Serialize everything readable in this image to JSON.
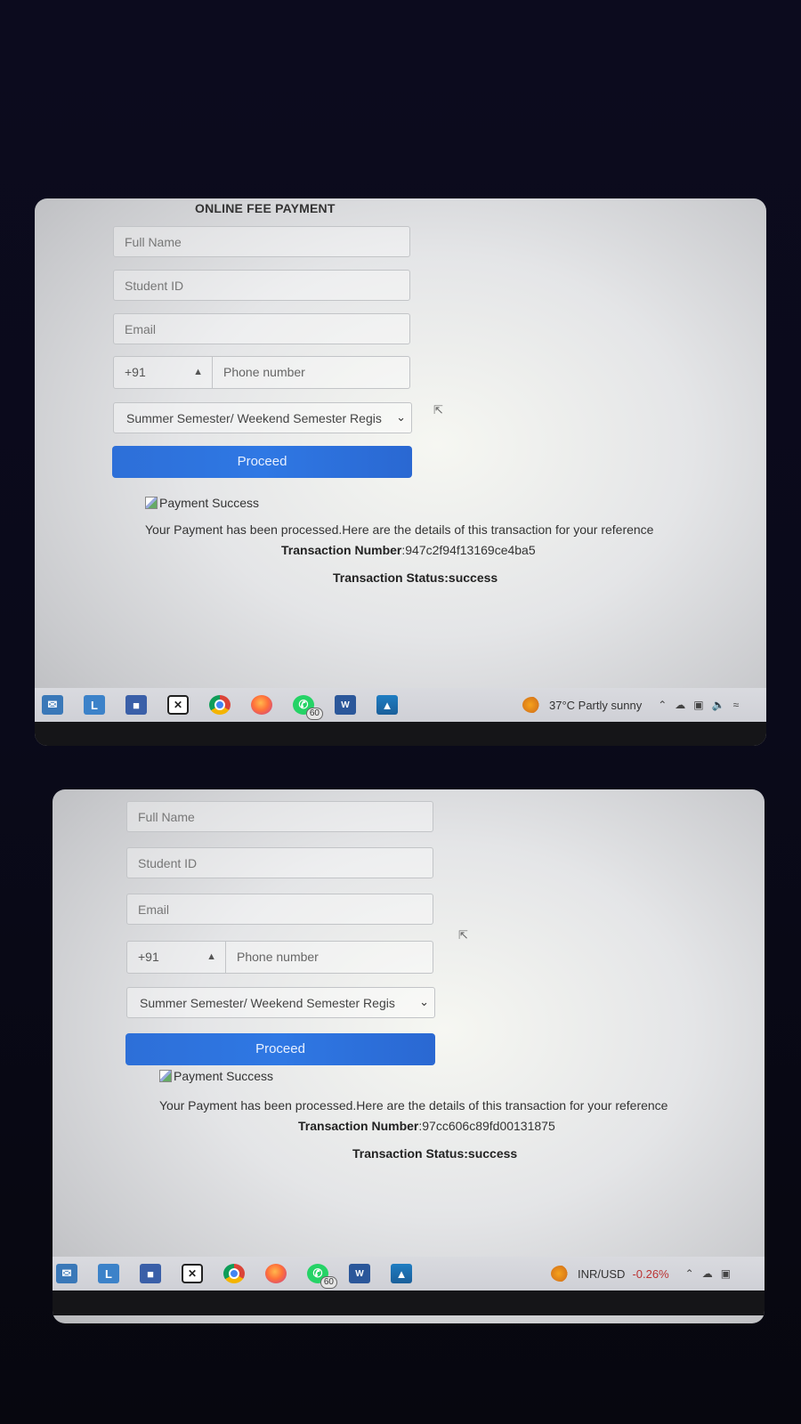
{
  "screens": [
    {
      "form_title": "ONLINE FEE PAYMENT",
      "full_name_placeholder": "Full Name",
      "student_id_placeholder": "Student ID",
      "email_placeholder": "Email",
      "country_code": "+91",
      "phone_placeholder": "Phone number",
      "category_selected": "Summer Semester/ Weekend Semester Regis",
      "proceed_label": "Proceed",
      "success_image_alt": "Payment Success",
      "message": "Your Payment has been processed.Here are the details of this transaction for your reference",
      "transaction_number_label": "Transaction Number",
      "transaction_number": ":947c2f94f13169ce4ba5",
      "transaction_status_label": "Transaction Status",
      "transaction_status": ":success",
      "taskbar_widget_text": "37°C  Partly sunny",
      "whatsapp_badge": "60"
    },
    {
      "full_name_placeholder": "Full Name",
      "student_id_placeholder": "Student ID",
      "email_placeholder": "Email",
      "country_code": "+91",
      "phone_placeholder": "Phone number",
      "category_selected": "Summer Semester/ Weekend Semester Regis",
      "proceed_label": "Proceed",
      "success_image_alt": "Payment Success",
      "message": "Your Payment has been processed.Here are the details of this transaction for your reference",
      "transaction_number_label": "Transaction Number",
      "transaction_number": ":97cc606c89fd00131875",
      "transaction_status_label": "Transaction Status",
      "transaction_status": ":success",
      "taskbar_widget_name": "INR/USD",
      "taskbar_widget_value": "-0.26%",
      "whatsapp_badge": "60"
    }
  ],
  "icons": {
    "taskbar": [
      "mail-icon",
      "l-app-icon",
      "store-icon",
      "xbox-icon",
      "chrome-icon",
      "firefox-icon",
      "whatsapp-icon",
      "word-icon",
      "photos-icon"
    ],
    "tray": [
      "chevron-up-icon",
      "cloud-icon",
      "display-icon",
      "speaker-icon",
      "wifi-icon"
    ]
  },
  "colors": {
    "proceed_button": "#2f78e4",
    "background": "#0a0a1a"
  }
}
